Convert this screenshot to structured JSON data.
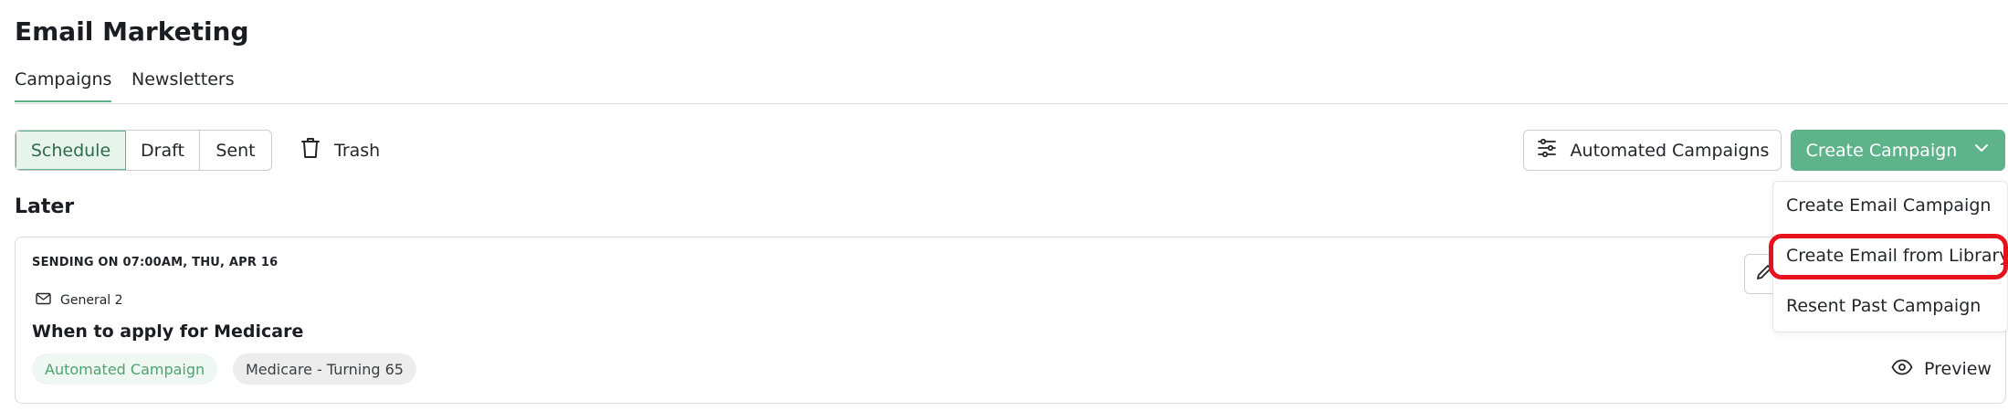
{
  "page": {
    "title": "Email Marketing"
  },
  "tabs": [
    {
      "label": "Campaigns",
      "active": true
    },
    {
      "label": "Newsletters",
      "active": false
    }
  ],
  "filters": {
    "segments": [
      {
        "label": "Schedule",
        "active": true
      },
      {
        "label": "Draft",
        "active": false
      },
      {
        "label": "Sent",
        "active": false
      }
    ],
    "trash_label": "Trash"
  },
  "toolbar": {
    "automated_label": "Automated Campaigns",
    "create_label": "Create Campaign"
  },
  "dropdown": {
    "items": [
      {
        "label": "Create Email Campaign"
      },
      {
        "label": "Create Email from Library",
        "highlighted": true
      },
      {
        "label": "Resent Past Campaign"
      }
    ]
  },
  "section": {
    "title": "Later"
  },
  "campaign": {
    "send_date": "SENDING ON 07:00AM, THU, APR 16",
    "list_name": "General 2",
    "title": "When to apply for Medicare",
    "tags": [
      "Automated Campaign",
      "Medicare - Turning 65"
    ],
    "preview_label": "Preview"
  },
  "colors": {
    "accent": "#5fb38a",
    "highlight": "#e8121c",
    "automated_tag_text": "#4ea36f"
  },
  "icons": [
    "trash-icon",
    "sliders-icon",
    "chevron-down-icon",
    "mail-icon",
    "pencil-icon",
    "eye-icon"
  ]
}
